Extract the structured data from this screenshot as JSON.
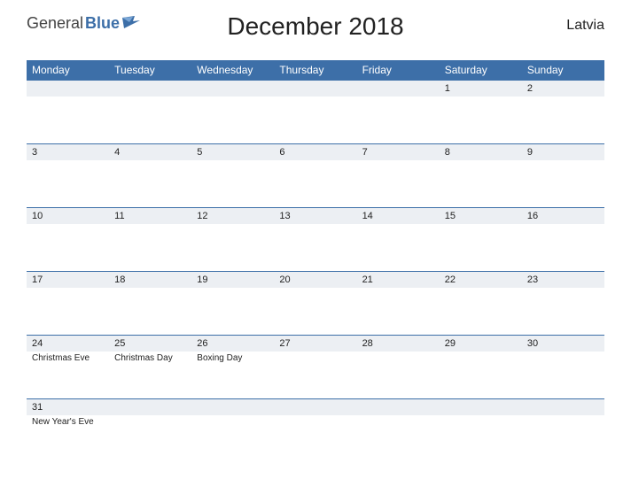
{
  "logo": {
    "part1": "General",
    "part2": "Blue"
  },
  "title": "December 2018",
  "region": "Latvia",
  "colors": {
    "accent": "#3d6fa8",
    "band": "#eceff3"
  },
  "weekdays": [
    "Monday",
    "Tuesday",
    "Wednesday",
    "Thursday",
    "Friday",
    "Saturday",
    "Sunday"
  ],
  "weeks": [
    [
      {
        "d": null
      },
      {
        "d": null
      },
      {
        "d": null
      },
      {
        "d": null
      },
      {
        "d": null
      },
      {
        "d": "1"
      },
      {
        "d": "2"
      }
    ],
    [
      {
        "d": "3"
      },
      {
        "d": "4"
      },
      {
        "d": "5"
      },
      {
        "d": "6"
      },
      {
        "d": "7"
      },
      {
        "d": "8"
      },
      {
        "d": "9"
      }
    ],
    [
      {
        "d": "10"
      },
      {
        "d": "11"
      },
      {
        "d": "12"
      },
      {
        "d": "13"
      },
      {
        "d": "14"
      },
      {
        "d": "15"
      },
      {
        "d": "16"
      }
    ],
    [
      {
        "d": "17"
      },
      {
        "d": "18"
      },
      {
        "d": "19"
      },
      {
        "d": "20"
      },
      {
        "d": "21"
      },
      {
        "d": "22"
      },
      {
        "d": "23"
      }
    ],
    [
      {
        "d": "24",
        "e": "Christmas Eve"
      },
      {
        "d": "25",
        "e": "Christmas Day"
      },
      {
        "d": "26",
        "e": "Boxing Day"
      },
      {
        "d": "27"
      },
      {
        "d": "28"
      },
      {
        "d": "29"
      },
      {
        "d": "30"
      }
    ],
    [
      {
        "d": "31",
        "e": "New Year's Eve"
      },
      {
        "d": null
      },
      {
        "d": null
      },
      {
        "d": null
      },
      {
        "d": null
      },
      {
        "d": null
      },
      {
        "d": null
      }
    ]
  ]
}
